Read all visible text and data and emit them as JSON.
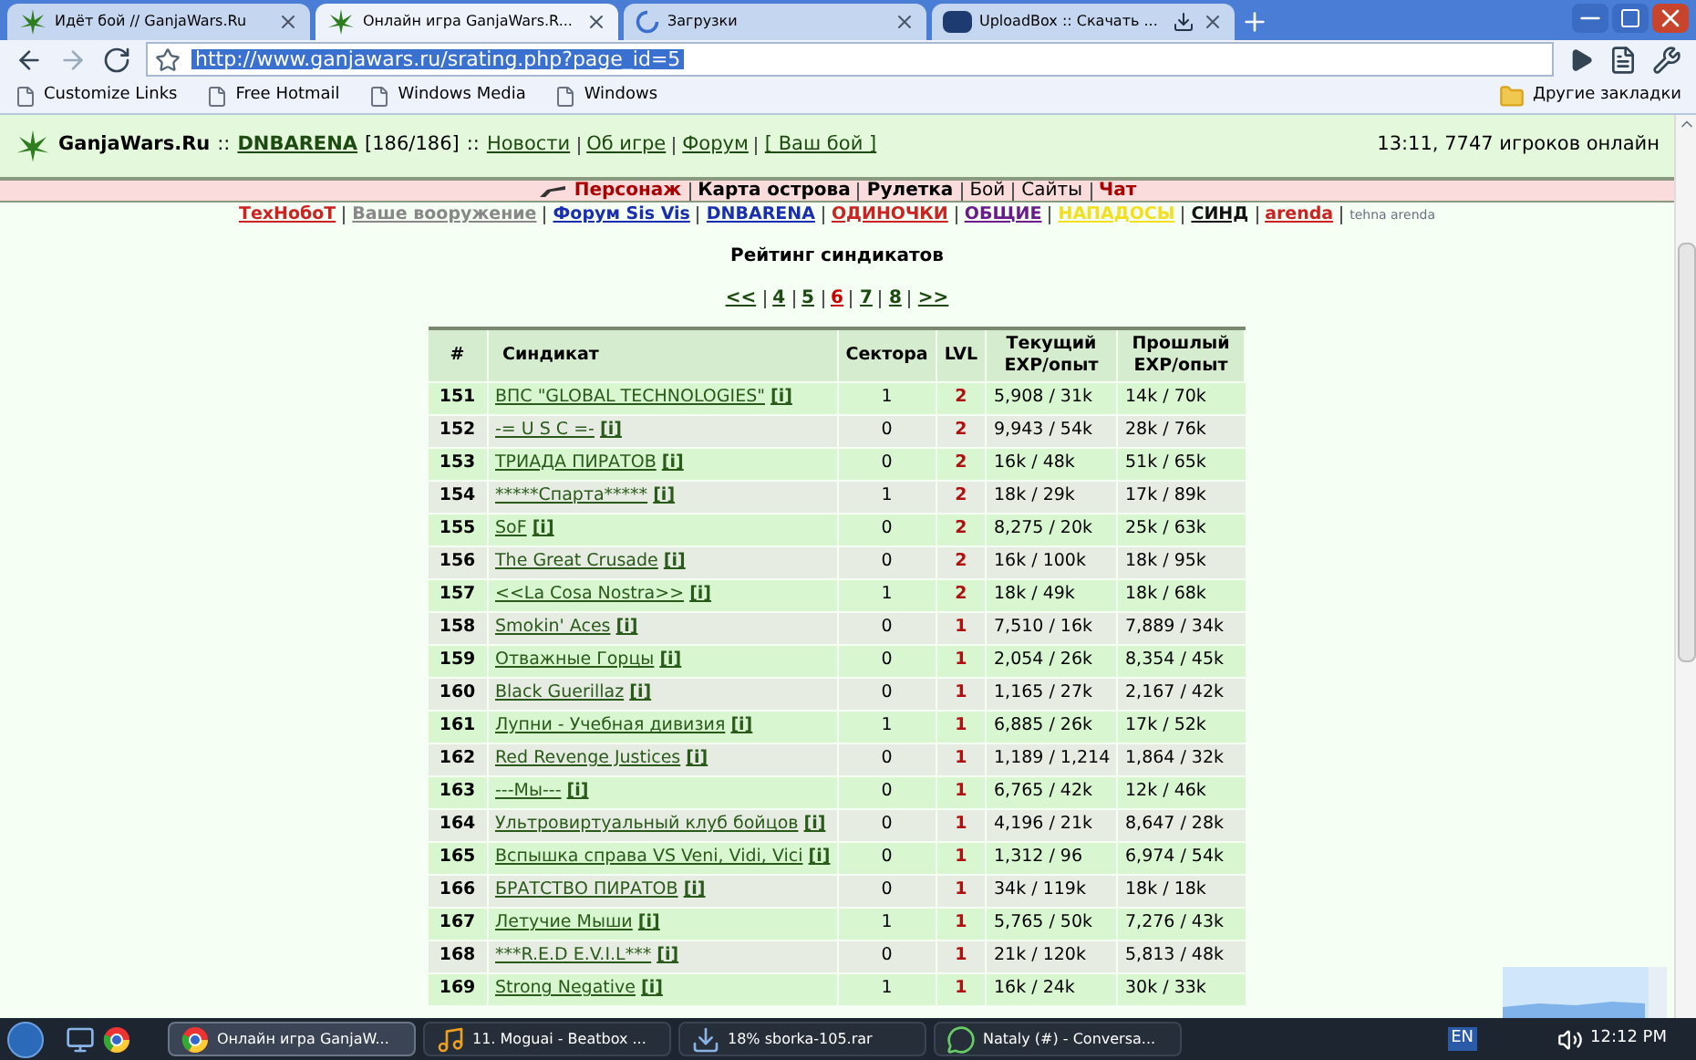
{
  "browser": {
    "tabs": [
      {
        "title": "Идёт бой // GanjaWars.Ru",
        "selected": false
      },
      {
        "title": "Онлайн игра GanjaWars.R...",
        "selected": true
      },
      {
        "title": "Загрузки",
        "selected": false
      },
      {
        "title": "UploadBox :: Скачать ...",
        "selected": false
      }
    ],
    "url": "http://www.ganjawars.ru/srating.php?page_id=5",
    "bookmarks": [
      "Customize Links",
      "Free Hotmail",
      "Windows Media",
      "Windows"
    ],
    "other_bookmarks": "Другие закладки"
  },
  "header": {
    "site": "GanjaWars.Ru",
    "sep1": "::",
    "arena": "DNBARENA",
    "arena_count": "[186/186]",
    "sep2": "::",
    "links": [
      "Новости",
      "Об игре",
      "Форум",
      "[ Ваш бой ]"
    ],
    "online": "13:11, 7747 игроков онлайн"
  },
  "main_nav": [
    {
      "label": "Персонаж",
      "bold": true
    },
    {
      "label": "Карта острова",
      "bold": true
    },
    {
      "label": "Рулетка",
      "bold": true
    },
    {
      "label": "Бой",
      "bold": false
    },
    {
      "label": "Сайты",
      "bold": false
    },
    {
      "label": "Чат",
      "bold": true
    }
  ],
  "sub_nav": [
    {
      "label": "ТехНобоТ",
      "color": "#cc2222"
    },
    {
      "label": "Ваше вооружение",
      "color": "#888888"
    },
    {
      "label": "Форум Sis Vis",
      "color": "#1a2fb0"
    },
    {
      "label": "DNBARENA",
      "color": "#1a2fb0"
    },
    {
      "label": "ОДИНОЧКИ",
      "color": "#cc2222"
    },
    {
      "label": "ОБЩИЕ",
      "color": "#6a1a8a"
    },
    {
      "label": "НАПАДОСЫ",
      "color": "#f2e020"
    },
    {
      "label": "СИНД",
      "color": "#111111"
    },
    {
      "label": "arenda",
      "color": "#cc2222"
    }
  ],
  "sub_nav_note": "tehna arenda",
  "title": "Рейтинг синдикатов",
  "pagination": [
    {
      "label": "<<",
      "selected": false
    },
    {
      "label": "4",
      "selected": false
    },
    {
      "label": "5",
      "selected": false
    },
    {
      "label": "6",
      "selected": true
    },
    {
      "label": "7",
      "selected": false
    },
    {
      "label": "8",
      "selected": false
    },
    {
      "label": ">>",
      "selected": false
    }
  ],
  "table": {
    "columns": [
      "#",
      "Синдикат",
      "Сектора",
      "LVL",
      "Текущий EXP/опыт",
      "Прошлый EXP/опыт"
    ],
    "rows": [
      {
        "info": "[i]",
        "cells": [
          "151",
          "ВПС \"GLOBAL TECHNOLOGIES\"",
          "1",
          "2",
          "5,908 / 31k",
          "14k / 70k"
        ]
      },
      {
        "info": "[i]",
        "cells": [
          "152",
          "-= U S C =-",
          "0",
          "2",
          "9,943 / 54k",
          "28k / 76k"
        ]
      },
      {
        "info": "[i]",
        "cells": [
          "153",
          "ТРИАДА ПИРАТОВ",
          "0",
          "2",
          "16k / 48k",
          "51k / 65k"
        ]
      },
      {
        "info": "[i]",
        "cells": [
          "154",
          "*****Спарта*****",
          "1",
          "2",
          "18k / 29k",
          "17k / 89k"
        ]
      },
      {
        "info": "[i]",
        "cells": [
          "155",
          "SoF",
          "0",
          "2",
          "8,275 / 20k",
          "25k / 63k"
        ]
      },
      {
        "info": "[i]",
        "cells": [
          "156",
          "The Great Crusade",
          "0",
          "2",
          "16k / 100k",
          "18k / 95k"
        ]
      },
      {
        "info": "[i]",
        "cells": [
          "157",
          "<<La Cosa Nostra>>",
          "1",
          "2",
          "18k / 49k",
          "18k / 68k"
        ]
      },
      {
        "info": "[i]",
        "cells": [
          "158",
          "Smokin' Aces",
          "0",
          "1",
          "7,510 / 16k",
          "7,889 / 34k"
        ]
      },
      {
        "info": "[i]",
        "cells": [
          "159",
          "Отважные Горцы",
          "0",
          "1",
          "2,054 / 26k",
          "8,354 / 45k"
        ]
      },
      {
        "info": "[i]",
        "cells": [
          "160",
          "Black Guerillaz",
          "0",
          "1",
          "1,165 / 27k",
          "2,167 / 42k"
        ]
      },
      {
        "info": "[i]",
        "cells": [
          "161",
          "Лупни - Учебная дивизия",
          "1",
          "1",
          "6,885 / 26k",
          "17k / 52k"
        ]
      },
      {
        "info": "[i]",
        "cells": [
          "162",
          "Red Revenge Justices",
          "0",
          "1",
          "1,189 / 1,214",
          "1,864 / 32k"
        ]
      },
      {
        "info": "[i]",
        "cells": [
          "163",
          "---Мы---",
          "0",
          "1",
          "6,765 / 42k",
          "12k / 46k"
        ]
      },
      {
        "info": "[i]",
        "cells": [
          "164",
          "Ультровиртуальный клуб бойцов",
          "0",
          "1",
          "4,196 / 21k",
          "8,647 / 28k"
        ]
      },
      {
        "info": "[i]",
        "cells": [
          "165",
          "Вспышка справа VS Veni, Vidi, Vici",
          "0",
          "1",
          "1,312 / 96",
          "6,974 / 54k"
        ]
      },
      {
        "info": "[i]",
        "cells": [
          "166",
          "БРАТСТВО ПИРАТОВ",
          "0",
          "1",
          "34k / 119k",
          "18k / 18k"
        ]
      },
      {
        "info": "[i]",
        "cells": [
          "167",
          "Летучие Мыши",
          "1",
          "1",
          "5,765 / 50k",
          "7,276 / 43k"
        ]
      },
      {
        "info": "[i]",
        "cells": [
          "168",
          "***R.E.D    E.V.I.L***",
          "0",
          "1",
          "21k / 120k",
          "5,813 / 48k"
        ]
      },
      {
        "info": "[i]",
        "cells": [
          "169",
          "Strong Negative",
          "1",
          "1",
          "16k / 24k",
          "30k / 33k"
        ]
      }
    ]
  },
  "taskbar": {
    "items": [
      {
        "label": "Онлайн игра GanjaW...",
        "selected": true
      },
      {
        "label": "11. Moguai - Beatbox ...",
        "selected": false
      },
      {
        "label": "18% sborka-105.rar",
        "selected": false
      },
      {
        "label": "Nataly (#) - Conversa...",
        "selected": false
      }
    ],
    "language": "EN",
    "clock": "12:12 PM"
  }
}
